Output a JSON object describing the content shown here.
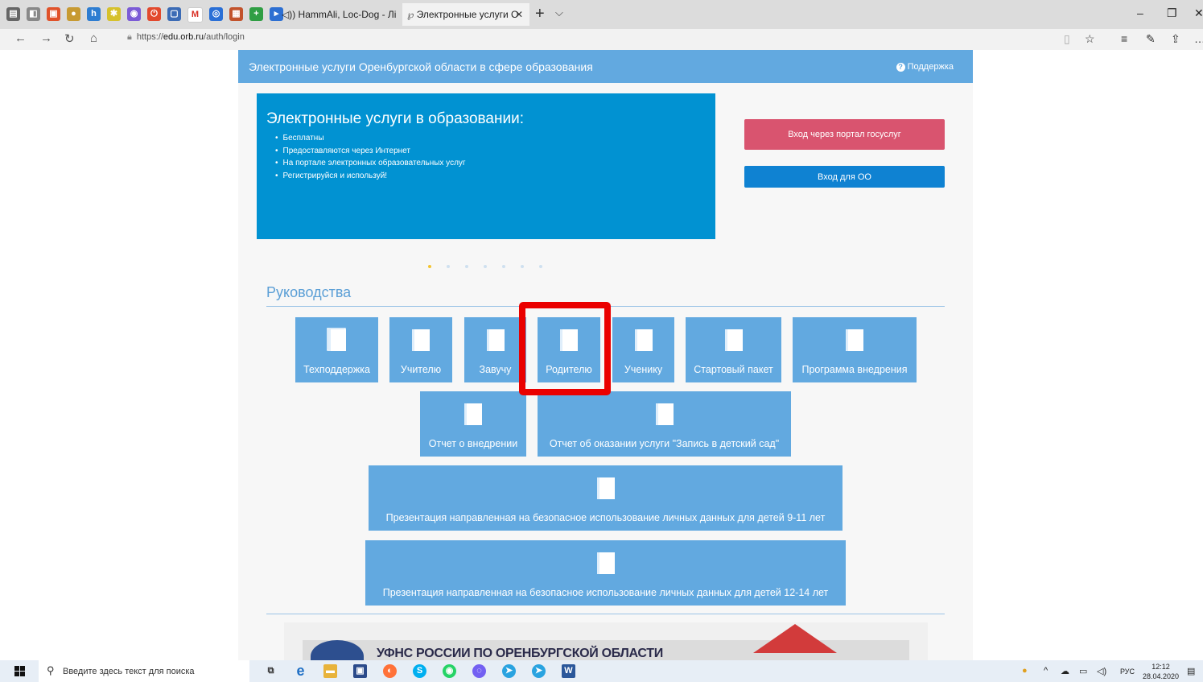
{
  "browser": {
    "tabs": [
      {
        "label": "◁)) HammAli, Loc-Dog - Лі"
      },
      {
        "label": "Электронные услуги О"
      }
    ],
    "new_tab": "+",
    "tab_menu": "⌵",
    "window_controls": {
      "minimize": "–",
      "restore": "❐",
      "close": "✕"
    },
    "url_prefix": "https://",
    "url_host": "edu.orb.ru",
    "url_path": "/auth/login"
  },
  "page": {
    "header": {
      "title": "Электронные услуги Оренбургской области в сфере образования",
      "support": "Поддержка"
    },
    "banner": {
      "title": "Электронные услуги в образовании:",
      "items": [
        "Бесплатны",
        "Предоставляются через Интернет",
        "На портале электронных образовательных услуг",
        "Регистрируйся и используй!"
      ]
    },
    "login": {
      "gosuslugi": "Вход через портал госуслуг",
      "oo": "Вход для ОО"
    },
    "carousel": {
      "slides": 7,
      "active": 1
    },
    "guides": {
      "title": "Руководства",
      "row1": [
        "Техподдержка",
        "Учителю",
        "Завучу",
        "Родителю",
        "Ученику",
        "Стартовый пакет",
        "Программа внедрения"
      ],
      "row2": [
        "Отчет о внедрении",
        "Отчет об оказании услуги \"Запись в детский сад\""
      ],
      "row3": [
        "Презентация направленная на безопасное использование личных данных для детей 9-11 лет"
      ],
      "row4": [
        "Презентация направленная на безопасное использование личных данных для детей 12-14 лет"
      ]
    },
    "ufns": {
      "text": "УФНС РОССИИ ПО ОРЕНБУРГСКОЙ ОБЛАСТИ"
    }
  },
  "taskbar": {
    "search_placeholder": "Введите здесь текст для поиска",
    "lang": "РУС",
    "time": "12:12",
    "date": "28.04.2020"
  },
  "colors": {
    "header": "#62a9e0",
    "banner": "#0192d2",
    "gosuslugi": "#d9546f",
    "oo": "#0f82d2",
    "highlight": "#ea0000"
  }
}
